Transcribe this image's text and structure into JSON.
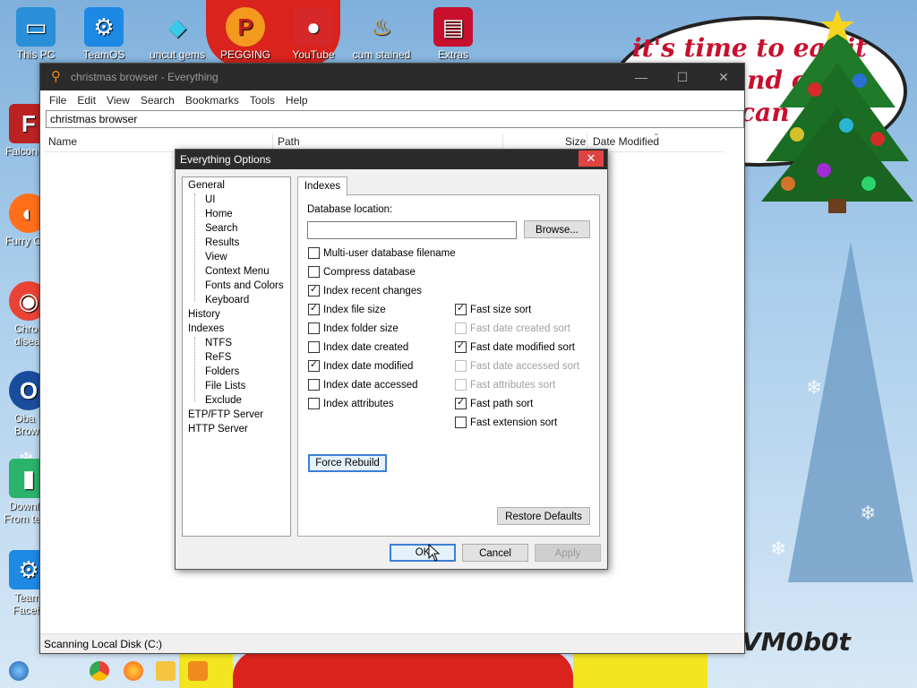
{
  "desktop": {
    "icons": [
      {
        "label": "This PC"
      },
      {
        "label": "TeamOS"
      },
      {
        "label": "uncut gems"
      },
      {
        "label": "PEGGING LOL"
      },
      {
        "label": "YouTube"
      },
      {
        "label": "cum stained"
      },
      {
        "label": "Extras"
      },
      {
        "label": "Falcon"
      },
      {
        "label": "Furry C"
      },
      {
        "label": "Chro"
      },
      {
        "label": "disea"
      },
      {
        "label": "Oba"
      },
      {
        "label": "Brow"
      },
      {
        "label": "Downl"
      },
      {
        "label": "From te"
      },
      {
        "label": "Team"
      },
      {
        "label": "Faceb"
      }
    ],
    "bubble_text_line1": "it's time to eat it",
    "bubble_text_line2": "and c",
    "bubble_text_line3": "can",
    "watermark": "VM0b0t"
  },
  "window": {
    "title": "christmas browser - Everything",
    "menu": [
      "File",
      "Edit",
      "View",
      "Search",
      "Bookmarks",
      "Tools",
      "Help"
    ],
    "search_value": "christmas browser",
    "columns": {
      "name": "Name",
      "path": "Path",
      "size": "Size",
      "date_modified": "Date Modified"
    },
    "status": "Scanning Local Disk (C:)"
  },
  "dialog": {
    "title": "Everything Options",
    "tree": [
      "General",
      "UI",
      "Home",
      "Search",
      "Results",
      "View",
      "Context Menu",
      "Fonts and Colors",
      "Keyboard",
      "History",
      "Indexes",
      "NTFS",
      "ReFS",
      "Folders",
      "File Lists",
      "Exclude",
      "ETP/FTP Server",
      "HTTP Server"
    ],
    "tab_label": "Indexes",
    "db_location_label": "Database location:",
    "db_location_value": "",
    "browse_label": "Browse...",
    "left_options": [
      {
        "label": "Multi-user database filename",
        "checked": false
      },
      {
        "label": "Compress database",
        "checked": false
      },
      {
        "label": "Index recent changes",
        "checked": true
      },
      {
        "label": "Index file size",
        "checked": true
      },
      {
        "label": "Index folder size",
        "checked": false
      },
      {
        "label": "Index date created",
        "checked": false
      },
      {
        "label": "Index date modified",
        "checked": true
      },
      {
        "label": "Index date accessed",
        "checked": false
      },
      {
        "label": "Index attributes",
        "checked": false
      }
    ],
    "right_options": [
      {
        "label": "Fast size sort",
        "checked": true,
        "enabled": true
      },
      {
        "label": "Fast date created sort",
        "checked": false,
        "enabled": false
      },
      {
        "label": "Fast date modified sort",
        "checked": true,
        "enabled": true
      },
      {
        "label": "Fast date accessed sort",
        "checked": false,
        "enabled": false
      },
      {
        "label": "Fast attributes sort",
        "checked": false,
        "enabled": false
      },
      {
        "label": "Fast path sort",
        "checked": true,
        "enabled": true
      },
      {
        "label": "Fast extension sort",
        "checked": false,
        "enabled": true
      }
    ],
    "force_rebuild_label": "Force Rebuild",
    "restore_defaults_label": "Restore Defaults",
    "ok_label": "OK",
    "cancel_label": "Cancel",
    "apply_label": "Apply"
  }
}
